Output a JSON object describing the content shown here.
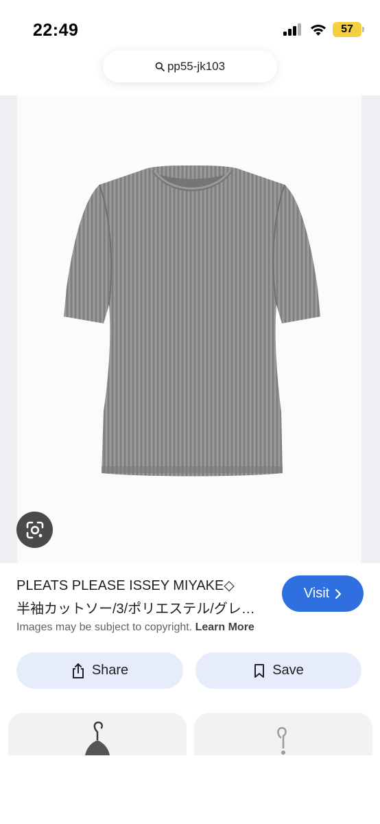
{
  "status_bar": {
    "time": "22:49",
    "battery": "57",
    "icons": [
      "cellular-signal-icon",
      "wifi-icon",
      "battery-icon"
    ],
    "battery_color": "#f4d03f"
  },
  "search": {
    "query": "pp55-jk103",
    "icon": "search-icon"
  },
  "result": {
    "title_line_1": "PLEATS PLEASE ISSEY MIYAKE◇",
    "title_line_2": "半袖カットソー/3/ポリエステル/グレ…",
    "visit_label": "Visit",
    "visit_color": "#2f6fe0",
    "copyright_text": "Images may be subject to copyright.",
    "learn_more_label": "Learn More"
  },
  "actions": {
    "share_label": "Share",
    "save_label": "Save",
    "button_color": "#e6ecfb"
  },
  "lens": {
    "icon": "lens-icon"
  },
  "product": {
    "description_icon": "grey-pleated-top-image"
  }
}
